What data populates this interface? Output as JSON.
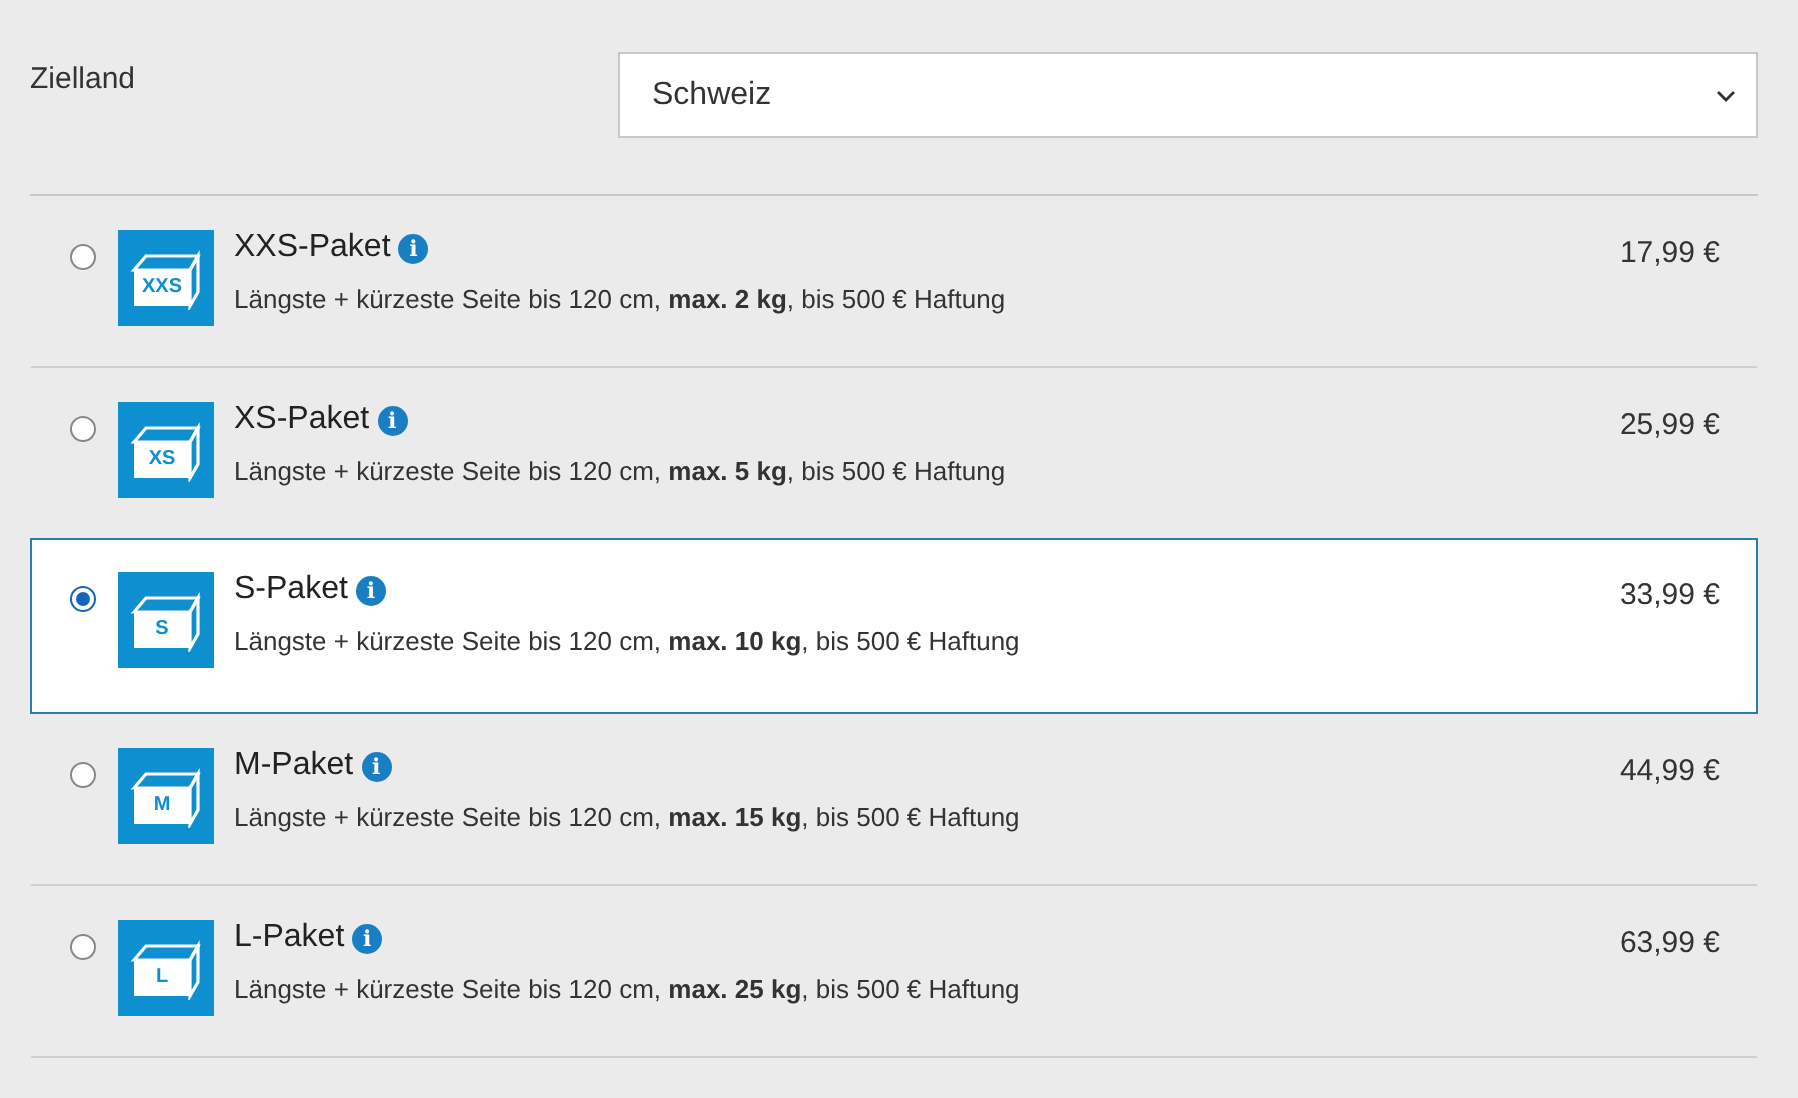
{
  "destination": {
    "label": "Zielland",
    "value": "Schweiz"
  },
  "packages": [
    {
      "icon_label": "XXS",
      "name": "XXS-Paket",
      "info": "i",
      "description": "Längste + kürzeste Seite bis 120 cm, **max. 2 kg**, bis 500 € Haftung",
      "price": "17,99 €",
      "selected": false
    },
    {
      "icon_label": "XS",
      "name": "XS-Paket",
      "info": "i",
      "description": "Längste + kürzeste Seite bis 120 cm, **max. 5 kg**, bis 500 € Haftung",
      "price": "25,99 €",
      "selected": false
    },
    {
      "icon_label": "S",
      "name": "S-Paket",
      "info": "i",
      "description": "Längste + kürzeste Seite bis 120 cm, **max. 10 kg**, bis 500 € Haftung",
      "price": "33,99 €",
      "selected": true
    },
    {
      "icon_label": "M",
      "name": "M-Paket",
      "info": "i",
      "description": "Längste + kürzeste Seite bis 120 cm, **max. 15 kg**, bis 500 € Haftung",
      "price": "44,99 €",
      "selected": false
    },
    {
      "icon_label": "L",
      "name": "L-Paket",
      "info": "i",
      "description": "Längste + kürzeste Seite bis 120 cm, **max. 25 kg**, bis 500 € Haftung",
      "price": "63,99 €",
      "selected": false
    }
  ]
}
